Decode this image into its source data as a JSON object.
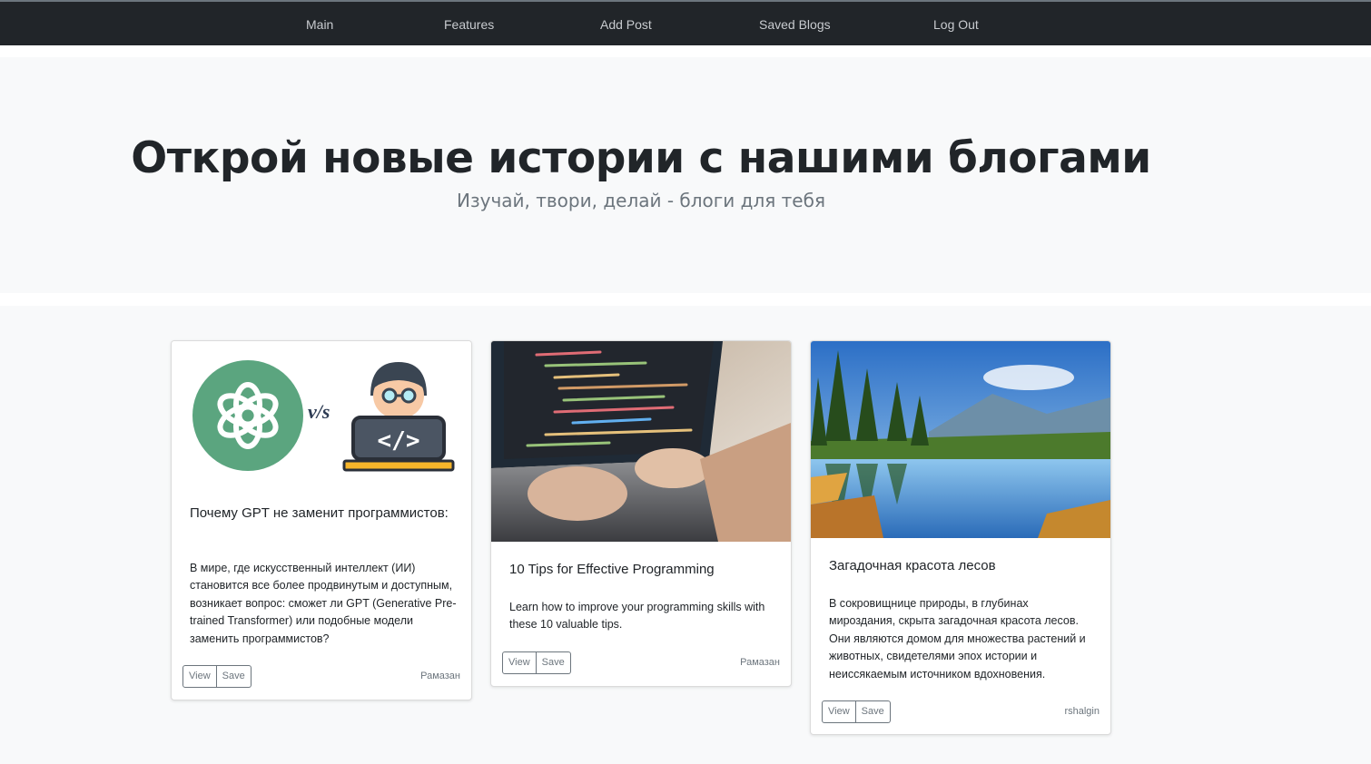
{
  "nav": {
    "items": [
      {
        "label": "Main"
      },
      {
        "label": "Features"
      },
      {
        "label": "Add Post"
      },
      {
        "label": "Saved Blogs"
      },
      {
        "label": "Log Out"
      }
    ]
  },
  "hero": {
    "title": "Открой новые истории с нашими блогами",
    "subtitle": "Изучай, твори, делай - блоги для тебя"
  },
  "cards": [
    {
      "image": "gpt-vs-programmer-illustration",
      "image_text": "v/s",
      "title": "Почему GPT не заменит программистов:",
      "text": "В мире, где искусственный интеллект (ИИ) становится все более продвинутым и доступным, возникает вопрос: сможет ли GPT (Generative Pre-trained Transformer) или подобные модели заменить программистов?",
      "view_label": "View",
      "save_label": "Save",
      "author": "Рамазан"
    },
    {
      "image": "laptop-code-photo",
      "title": "10 Tips for Effective Programming",
      "text": "Learn how to improve your programming skills with these 10 valuable tips.",
      "view_label": "View",
      "save_label": "Save",
      "author": "Рамазан"
    },
    {
      "image": "forest-lake-photo",
      "title": "Загадочная красота лесов",
      "text": "В сокровищнице природы, в глубинах мироздания, скрыта загадочная красота лесов. Они являются домом для множества растений и животных, свидетелями эпох истории и неиссякаемым источником вдохновения.",
      "view_label": "View",
      "save_label": "Save",
      "author": "rshalgin"
    }
  ],
  "colors": {
    "navbar": "#212529",
    "hero_bg": "#f8f9fa",
    "openai_green": "#5ba57f"
  }
}
